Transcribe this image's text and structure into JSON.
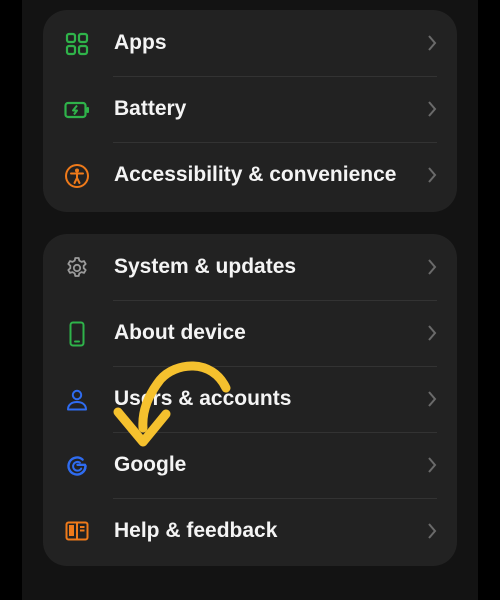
{
  "settings": {
    "group1": [
      {
        "label": "Apps",
        "icon": "apps-grid-icon"
      },
      {
        "label": "Battery",
        "icon": "battery-icon"
      },
      {
        "label": "Accessibility & convenience",
        "icon": "accessibility-icon"
      }
    ],
    "group2": [
      {
        "label": "System & updates",
        "icon": "gear-icon"
      },
      {
        "label": "About device",
        "icon": "phone-icon"
      },
      {
        "label": "Users & accounts",
        "icon": "user-icon"
      },
      {
        "label": "Google",
        "icon": "google-icon"
      },
      {
        "label": "Help & feedback",
        "icon": "help-book-icon"
      }
    ]
  },
  "colors": {
    "background": "#131313",
    "card": "#222222",
    "text": "#f4f4f4",
    "green": "#2fb34a",
    "orange": "#ef7a1a",
    "blue": "#2f6cf0",
    "gray_icon": "#9b9b9b",
    "chevron": "#6a6a6a",
    "annotation_arrow": "#f5c12e"
  }
}
